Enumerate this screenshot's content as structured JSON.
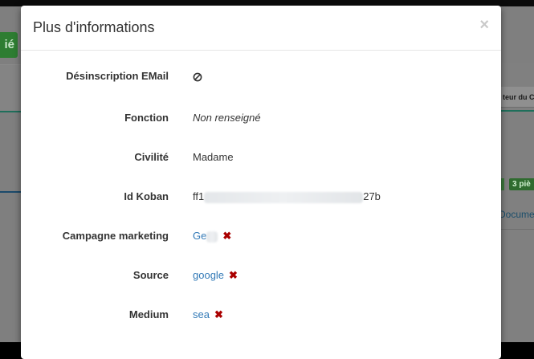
{
  "background": {
    "button_text": "ié",
    "column_header": "teur du Co",
    "badge_text": "3 piè",
    "doc_link": "Docume"
  },
  "modal": {
    "title": "Plus d'informations",
    "close": "×",
    "rows": [
      {
        "label": "Désinscription EMail",
        "value_icon": "ban-icon"
      },
      {
        "label": "Fonction",
        "value": "Non renseigné"
      },
      {
        "label": "Civilité",
        "value": "Madame"
      },
      {
        "label": "Id Koban",
        "value_prefix": "ff1",
        "value_suffix": "27b"
      },
      {
        "label": "Campagne marketing",
        "value": "Ge",
        "remove": "✖"
      },
      {
        "label": "Source",
        "value": "google",
        "remove": "✖"
      },
      {
        "label": "Medium",
        "value": "sea",
        "remove": "✖"
      }
    ]
  },
  "colors": {
    "link": "#337ab7",
    "remove": "#aa0000",
    "overlay": "#7f7f7f"
  }
}
